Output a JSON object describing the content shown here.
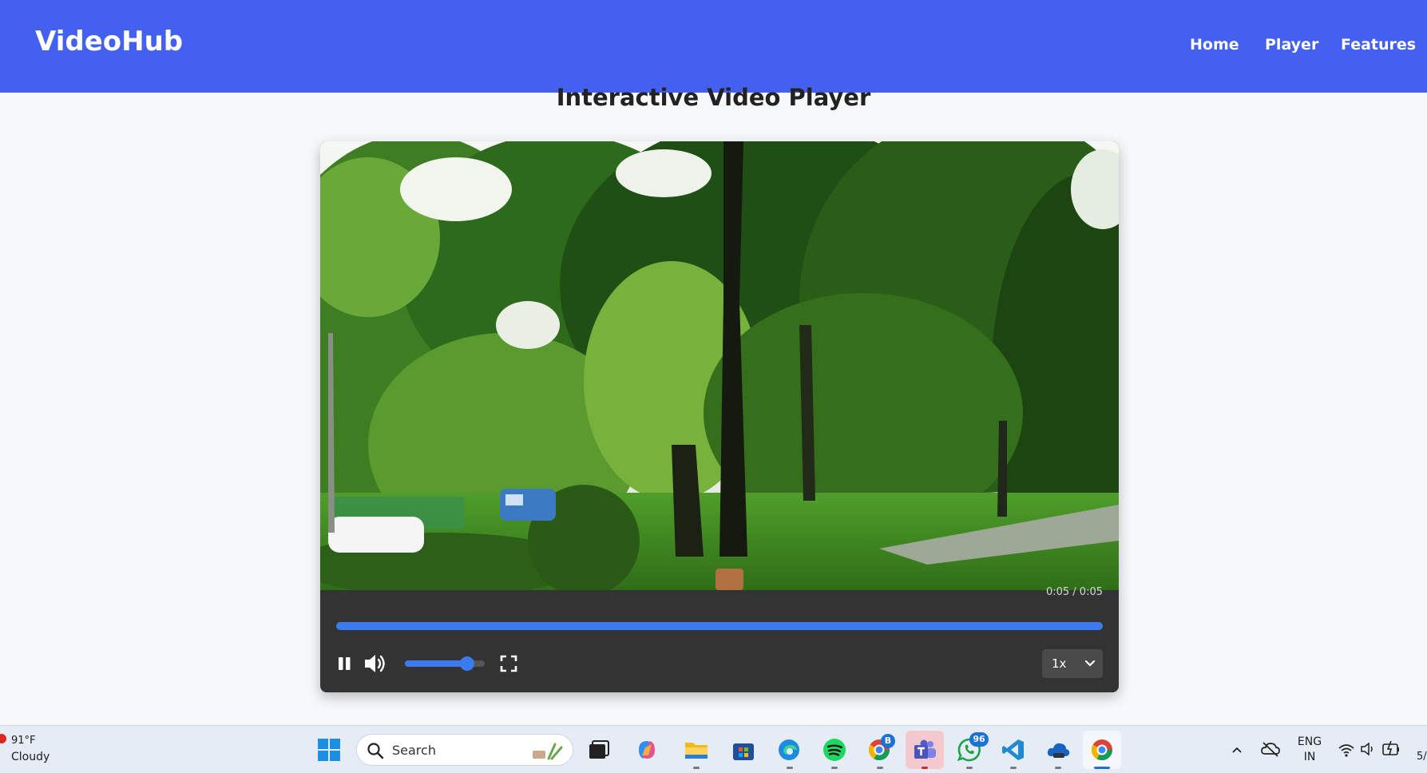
{
  "header": {
    "brand": "VideoHub",
    "nav": [
      "Home",
      "Player",
      "Features"
    ]
  },
  "page": {
    "title": "Interactive Video Player"
  },
  "player": {
    "time_display": "0:05 / 0:05",
    "progress_fraction": 1.0,
    "volume_fraction": 0.78,
    "playback_state": "playing",
    "speed": "1x",
    "icons": [
      "pause-icon",
      "volume-icon",
      "fullscreen-icon",
      "chevron-down-icon"
    ],
    "colors": {
      "accent": "#3a7bf0",
      "controls_bg": "#333333"
    }
  },
  "taskbar": {
    "weather_temp": "91°F",
    "weather_condition": "Cloudy",
    "search_placeholder": "Search",
    "whatsapp_badge": "96",
    "chrome_badge": "B",
    "language": "ENG",
    "region": "IN",
    "clock_partial": "5/",
    "apps": [
      "windows-start",
      "search",
      "task-view",
      "copilot",
      "file-explorer",
      "microsoft-store",
      "edge",
      "spotify",
      "chrome-profile",
      "teams",
      "whatsapp",
      "vscode",
      "onedrive-cloud",
      "chrome"
    ]
  },
  "colors": {
    "header_bg": "#4361ee",
    "page_bg": "#f7f8fa"
  }
}
